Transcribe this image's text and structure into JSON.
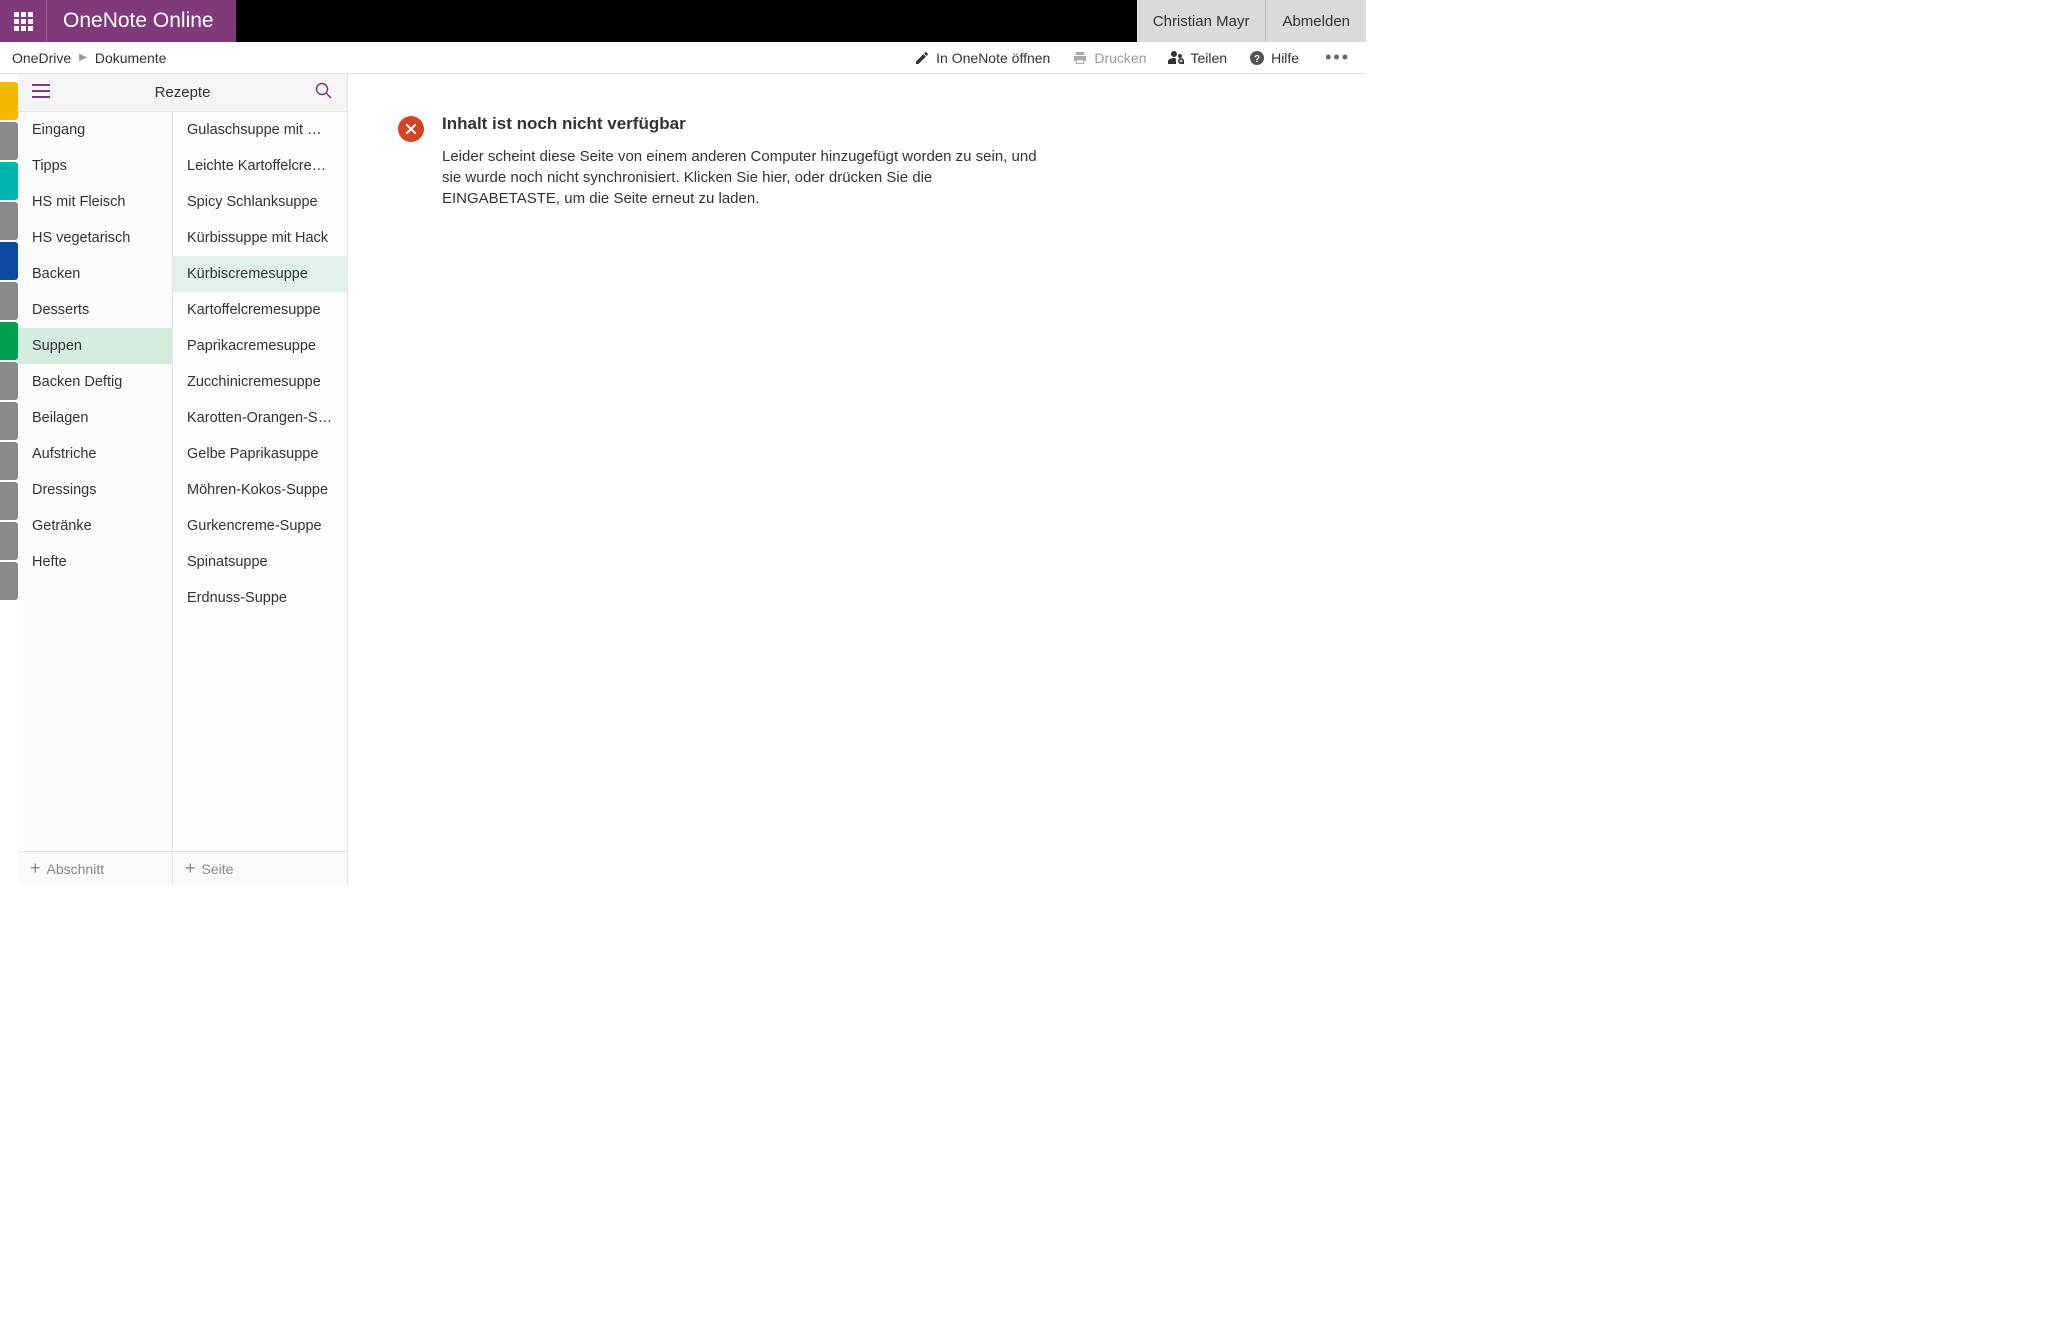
{
  "header": {
    "app_title": "OneNote Online",
    "user_name": "Christian Mayr",
    "signout_label": "Abmelden"
  },
  "breadcrumb": {
    "root": "OneDrive",
    "folder": "Dokumente"
  },
  "toolbar": {
    "open_in_onenote": "In OneNote öffnen",
    "print": "Drucken",
    "share": "Teilen",
    "help": "Hilfe"
  },
  "nav": {
    "notebook_title": "Rezepte",
    "add_section": "Abschnitt",
    "add_page": "Seite"
  },
  "section_tabs_colors": [
    "#f2b900",
    "#8a8a8a",
    "#00b5ad",
    "#8a8a8a",
    "#0b4a9e",
    "#8a8a8a",
    "#009e4f",
    "#8a8a8a",
    "#8a8a8a",
    "#8a8a8a",
    "#8a8a8a",
    "#8a8a8a",
    "#8a8a8a"
  ],
  "sections": [
    {
      "label": "Eingang",
      "selected": false
    },
    {
      "label": "Tipps",
      "selected": false
    },
    {
      "label": "HS mit Fleisch",
      "selected": false
    },
    {
      "label": "HS vegetarisch",
      "selected": false
    },
    {
      "label": "Backen",
      "selected": false
    },
    {
      "label": "Desserts",
      "selected": false
    },
    {
      "label": "Suppen",
      "selected": true
    },
    {
      "label": "Backen Deftig",
      "selected": false
    },
    {
      "label": "Beilagen",
      "selected": false
    },
    {
      "label": "Aufstriche",
      "selected": false
    },
    {
      "label": "Dressings",
      "selected": false
    },
    {
      "label": "Getränke",
      "selected": false
    },
    {
      "label": "Hefte",
      "selected": false
    }
  ],
  "pages": [
    {
      "label": "Gulaschsuppe mit Mini…",
      "selected": false
    },
    {
      "label": "Leichte Kartoffelcreme…",
      "selected": false
    },
    {
      "label": "Spicy Schlanksuppe",
      "selected": false
    },
    {
      "label": "Kürbissuppe mit Hack",
      "selected": false
    },
    {
      "label": "Kürbiscremesuppe",
      "selected": true
    },
    {
      "label": "Kartoffelcremesuppe",
      "selected": false
    },
    {
      "label": "Paprikacremesuppe",
      "selected": false
    },
    {
      "label": "Zucchinicremesuppe",
      "selected": false
    },
    {
      "label": "Karotten-Orangen-Sup…",
      "selected": false
    },
    {
      "label": "Gelbe Paprikasuppe",
      "selected": false
    },
    {
      "label": "Möhren-Kokos-Suppe",
      "selected": false
    },
    {
      "label": "Gurkencreme-Suppe",
      "selected": false
    },
    {
      "label": "Spinatsuppe",
      "selected": false
    },
    {
      "label": "Erdnuss-Suppe",
      "selected": false
    }
  ],
  "content_error": {
    "title": "Inhalt ist noch nicht verfügbar",
    "body": "Leider scheint diese Seite von einem anderen Computer hinzugefügt worden zu sein, und sie wurde noch nicht synchronisiert. Klicken Sie hier, oder drücken Sie die EINGABETASTE, um die Seite erneut zu laden."
  }
}
